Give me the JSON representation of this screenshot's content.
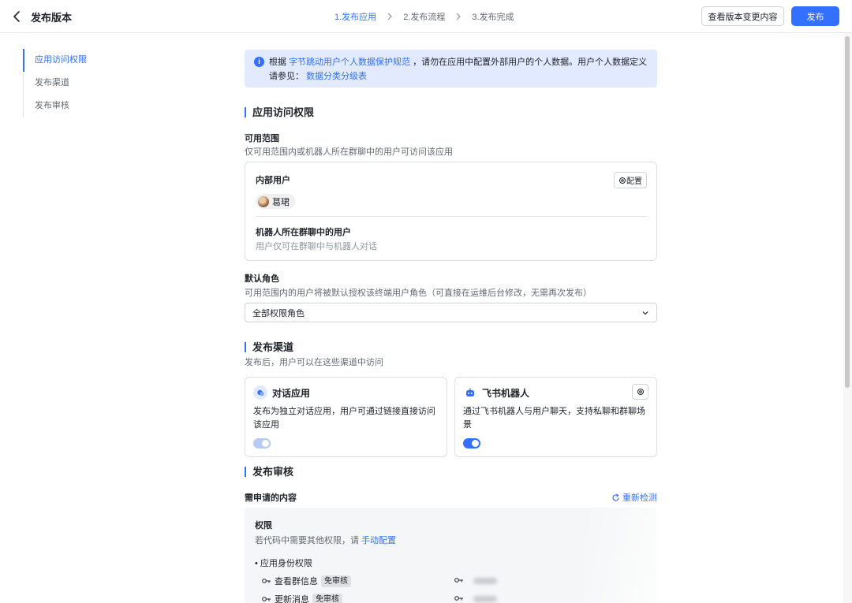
{
  "header": {
    "title": "发布版本",
    "steps": [
      "1.发布应用",
      "2.发布流程",
      "3.发布完成"
    ],
    "view_changes_label": "查看版本变更内容",
    "publish_label": "发布"
  },
  "sidebar": {
    "items": [
      {
        "label": "应用访问权限",
        "active": true
      },
      {
        "label": "发布渠道",
        "active": false
      },
      {
        "label": "发布审核",
        "active": false
      }
    ]
  },
  "notice": {
    "prefix": "根据",
    "link1": "字节跳动用户个人数据保护规范",
    "middle": "，请勿在应用中配置外部用户的个人数据。用户个人数据定义请参见：",
    "link2": "数据分类分级表"
  },
  "access": {
    "title": "应用访问权限",
    "scope_label": "可用范围",
    "scope_desc": "仅可用范围内或机器人所在群聊中的用户可访问该应用",
    "internal_title": "内部用户",
    "config_label": "配置",
    "user_name": "葛珺",
    "bot_users_title": "机器人所在群聊中的用户",
    "bot_users_desc": "用户仅可在群聊中与机器人对话",
    "role_label": "默认角色",
    "role_desc": "可用范围内的用户将被默认授权该终端用户角色（可直接在运维后台修改，无需再次发布）",
    "role_value": "全部权限角色"
  },
  "channels": {
    "title": "发布渠道",
    "desc": "发布后，用户可以在这些渠道中访问",
    "items": [
      {
        "title": "对话应用",
        "desc": "发布为独立对话应用，用户可通过链接直接访问该应用",
        "enabled": true,
        "disabled_look": true
      },
      {
        "title": "飞书机器人",
        "desc": "通过飞书机器人与用户聊天，支持私聊和群聊场景",
        "enabled": true,
        "disabled_look": false
      }
    ]
  },
  "review": {
    "title": "发布审核",
    "content_label": "需申请的内容",
    "recheck_label": "重新检测",
    "perm_title": "权限",
    "perm_desc_prefix": "若代码中需要其他权限，请",
    "perm_desc_link": "手动配置",
    "group_label": "应用身份权限",
    "perms": [
      {
        "name": "查看群信息",
        "tag": "免审核"
      },
      {
        "name": "更新消息",
        "tag": "免审核"
      }
    ]
  },
  "colors": {
    "accent": "#3370ff",
    "notice_bg": "#e1eaff"
  }
}
